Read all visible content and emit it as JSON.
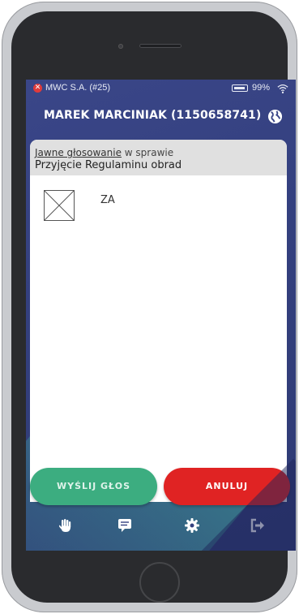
{
  "status_bar": {
    "app_label": "MWC S.A. (#25)",
    "battery_percent": "99%",
    "alert_icon": "close-circle-icon",
    "wifi_icon": "wifi-icon"
  },
  "header": {
    "title": "MAREK MARCINIAK (1150658741)",
    "language_icon": "globe-icon"
  },
  "vote": {
    "link_text": "Jawne głosowanie",
    "in_matter": " w sprawie",
    "subject": "Przyjęcie Regulaminu obrad",
    "options": [
      {
        "label": "ZA",
        "checked": true
      }
    ]
  },
  "actions": {
    "send_label": "WYŚLIJ GŁOS",
    "cancel_label": "ANULUJ"
  },
  "bottom_nav": {
    "items": [
      "hand-icon",
      "comment-icon",
      "gear-icon",
      "sign-out-icon"
    ]
  },
  "colors": {
    "background": "#34407f",
    "send_button": "#3cad80",
    "cancel_button": "#e02323",
    "card_header": "#e0e0e0"
  }
}
